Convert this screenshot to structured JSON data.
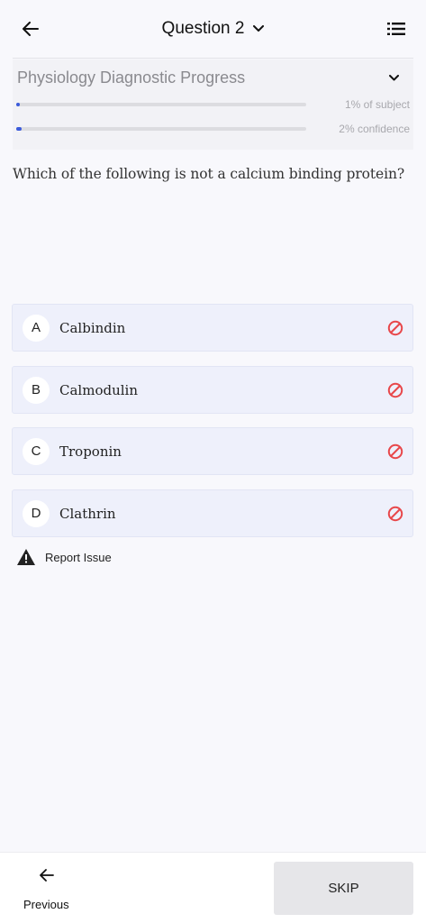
{
  "header": {
    "title": "Question 2",
    "back_icon": "arrow-left-icon",
    "dropdown_icon": "chevron-down-icon",
    "menu_icon": "list-icon"
  },
  "progress": {
    "title": "Physiology Diagnostic Progress",
    "subject_label": "1% of subject",
    "subject_value": 0.01,
    "confidence_label": "2% confidence",
    "confidence_value": 0.02,
    "accent_color": "#3b5bdb"
  },
  "question": {
    "text": "Which of the following is not a calcium binding protein?"
  },
  "options": [
    {
      "letter": "A",
      "text": "Calbindin"
    },
    {
      "letter": "B",
      "text": "Calmodulin"
    },
    {
      "letter": "C",
      "text": "Troponin"
    },
    {
      "letter": "D",
      "text": "Clathrin"
    }
  ],
  "report": {
    "label": "Report Issue",
    "icon": "warning-icon"
  },
  "footer": {
    "previous_label": "Previous",
    "skip_label": "SKIP"
  }
}
